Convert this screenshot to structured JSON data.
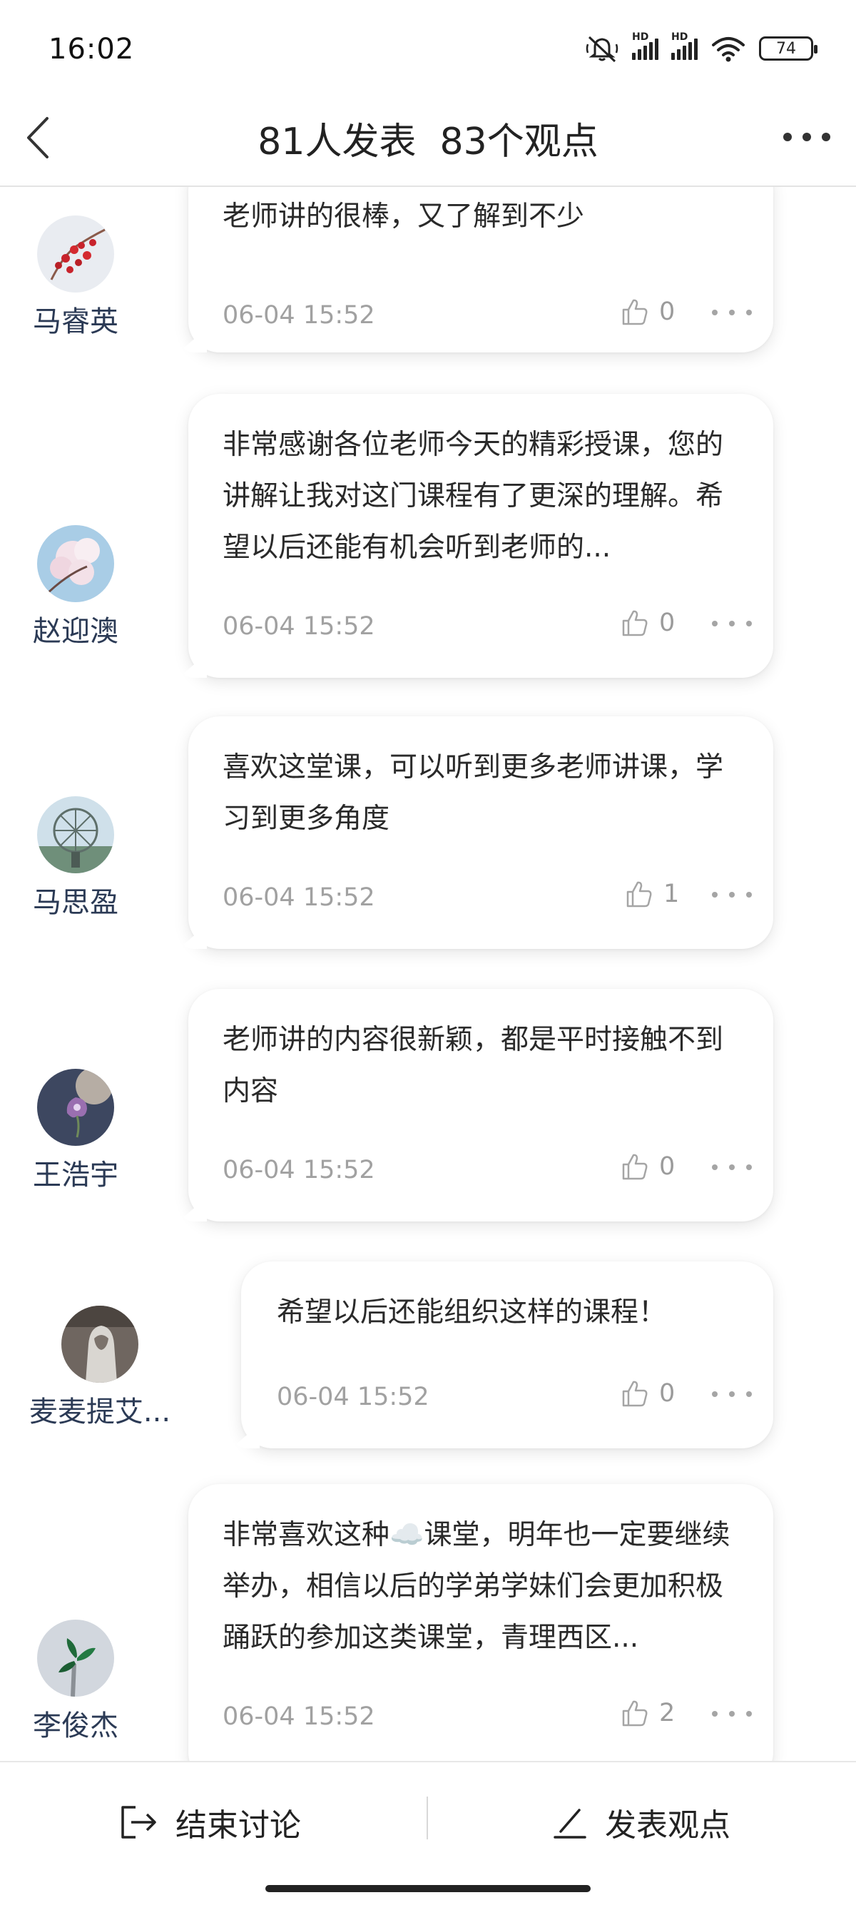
{
  "status": {
    "time": "16:02",
    "battery": "74",
    "hd1": "HD",
    "hd2": "HD"
  },
  "nav": {
    "participants": "81人发表",
    "opinions": "83个观点"
  },
  "posts": [
    {
      "name": "马睿英",
      "text": "老师讲的很棒，又了解到不少",
      "time": "06-04 15:52",
      "likes": "0"
    },
    {
      "name": "赵迎澳",
      "text": "非常感谢各位老师今天的精彩授课，您的讲解让我对这门课程有了更深的理解。希望以后还能有机会听到老师的...",
      "time": "06-04 15:52",
      "likes": "0"
    },
    {
      "name": "马思盈",
      "text": "喜欢这堂课，可以听到更多老师讲课，学习到更多角度",
      "time": "06-04 15:52",
      "likes": "1"
    },
    {
      "name": "王浩宇",
      "text": "老师讲的内容很新颖，都是平时接触不到内容",
      "time": "06-04 15:52",
      "likes": "0"
    },
    {
      "name": "麦麦提艾...",
      "text": "希望以后还能组织这样的课程！",
      "time": "06-04 15:52",
      "likes": "0"
    },
    {
      "name": "李俊杰",
      "text": "非常喜欢这种☁️课堂，明年也一定要继续举办，相信以后的学弟学妹们会更加积极踊跃的参加这类课堂，青理西区...",
      "time": "06-04 15:52",
      "likes": "2"
    }
  ],
  "bottom": {
    "end_label": "结束讨论",
    "post_label": "发表观点"
  }
}
